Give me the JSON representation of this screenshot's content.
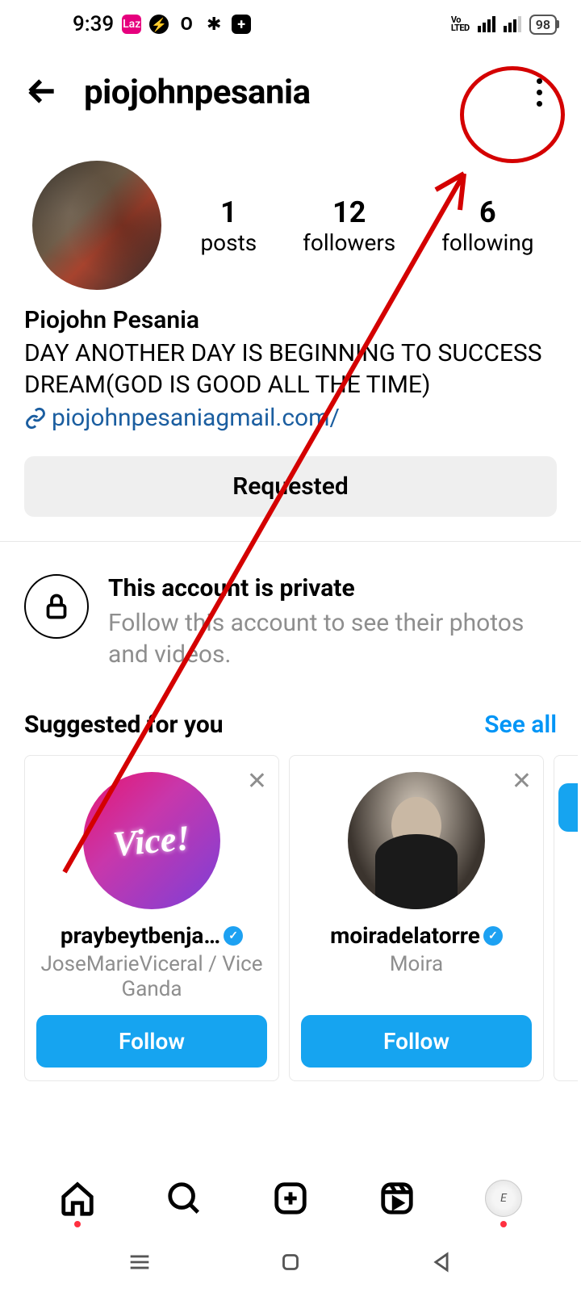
{
  "status": {
    "time": "9:39",
    "battery": "98",
    "volte": "Vo\nLTED"
  },
  "header": {
    "username": "piojohnpesania"
  },
  "stats": {
    "posts_count": "1",
    "posts_label": "posts",
    "followers_count": "12",
    "followers_label": "followers",
    "following_count": "6",
    "following_label": "following"
  },
  "bio": {
    "display_name": "Piojohn Pesania",
    "text": "DAY ANOTHER DAY IS BEGINNING TO SUCCESS DREAM(GOD IS GOOD ALL THE TIME)",
    "link_text": "piojohnpesaniagmail.com/"
  },
  "action": {
    "requested": "Requested"
  },
  "private": {
    "title": "This account is private",
    "subtitle": "Follow this account to see their photos and videos."
  },
  "suggested": {
    "title": "Suggested for you",
    "see_all": "See all",
    "cards": [
      {
        "avatar_text": "Vice!",
        "username": "praybeytbenja…",
        "verified": true,
        "subtitle": "JoseMarieViceral / Vice Ganda",
        "follow": "Follow"
      },
      {
        "username": "moiradelatorre",
        "verified": true,
        "subtitle": "Moira",
        "follow": "Follow"
      }
    ]
  }
}
